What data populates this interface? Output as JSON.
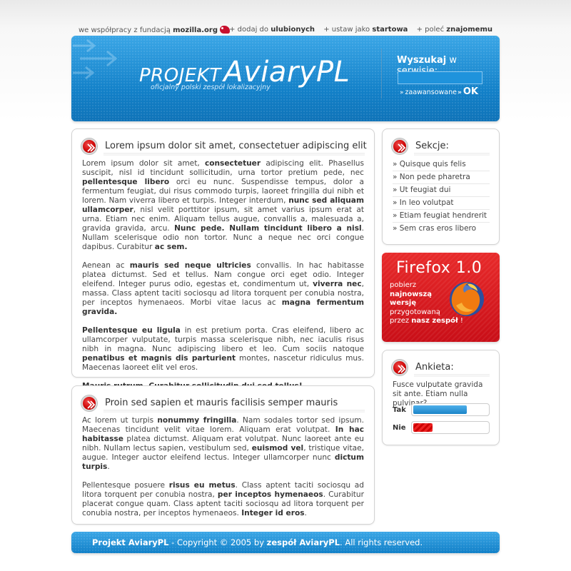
{
  "topbar": {
    "partner_prefix": "we współpracy z fundacją",
    "partner_name": "mozilla.org",
    "links": [
      {
        "prefix": "+ dodaj do",
        "bold": "ulubionych"
      },
      {
        "prefix": "+ ustaw jako",
        "bold": "startowa"
      },
      {
        "prefix": "+ poleć",
        "bold": "znajomemu"
      }
    ]
  },
  "header": {
    "title_part1": "PROJEKT",
    "title_part2": "AviaryPL",
    "subtitle": "oficjalny polski zespół lokalizacyjny",
    "search_label_bold": "Wyszukaj",
    "search_label_rest": "w serwisie:",
    "search_value": "",
    "advanced_label": "zaawansowane",
    "ok_label": "OK"
  },
  "articles": [
    {
      "title": "Lorem ipsum dolor sit amet, consectetuer adipiscing elit",
      "paragraphs": [
        [
          {
            "t": "Lorem ipsum dolor sit amet, "
          },
          {
            "t": "consectetuer",
            "b": true
          },
          {
            "t": " adipiscing elit. Phasellus suscipit, nisl id tincidunt sollicitudin, urna tortor pretium pede, nec "
          },
          {
            "t": "pellentesque libero",
            "b": true
          },
          {
            "t": " orci eu nunc. Suspendisse tempus, dolor a fermentum feugiat, dui risus commodo turpis, laoreet fringilla dui nibh et lorem. Nam viverra libero et turpis. Integer interdum, "
          },
          {
            "t": "nunc sed aliquam ullamcorper",
            "b": true
          },
          {
            "t": ", nisl velit porttitor ipsum, sit amet varius ipsum erat at urna. Etiam nec enim. Aliquam tellus augue, convallis a, malesuada a, gravida gravida, arcu. "
          },
          {
            "t": "Nunc pede. Nullam tincidunt libero a nisl",
            "b": true
          },
          {
            "t": ". Nullam scelerisque odio non tortor. Nunc a neque nec orci congue dapibus. Curabitur "
          },
          {
            "t": "ac sem.",
            "b": true
          }
        ],
        [
          {
            "t": "Aenean ac "
          },
          {
            "t": "mauris sed neque ultricies",
            "b": true
          },
          {
            "t": " convallis. In hac habitasse platea dictumst. Sed et tellus. Nam congue orci eget odio. Integer eleifend. Integer purus odio, egestas et, condimentum ut, "
          },
          {
            "t": "viverra nec",
            "b": true
          },
          {
            "t": ", massa. Class aptent taciti sociosqu ad litora torquent per conubia nostra, per inceptos hymenaeos. Morbi vitae lacus ac "
          },
          {
            "t": "magna fermentum gravida.",
            "b": true
          }
        ],
        [
          {
            "t": "Pellentesque eu ligula",
            "b": true
          },
          {
            "t": " in est pretium porta. Cras eleifend, libero ac ullamcorper vulputate, turpis massa scelerisque nibh, nec iaculis risus nibh in magna. Nunc adipiscing libero et leo. Cum sociis natoque "
          },
          {
            "t": "penatibus et magnis dis parturient",
            "b": true
          },
          {
            "t": " montes, nascetur ridiculus mus. Maecenas laoreet elit vel eros."
          }
        ],
        [
          {
            "t": "Mauris rutrum. Curabitur sollicitudin dui sed tellus!",
            "b": true
          }
        ]
      ]
    },
    {
      "title": "Proin sed sapien et mauris facilisis semper mauris",
      "paragraphs": [
        [
          {
            "t": "Ac lorem ut turpis "
          },
          {
            "t": "nonummy fringilla",
            "b": true
          },
          {
            "t": ". Nam sodales tortor sed ipsum. Maecenas tincidunt velit vitae lorem. Aliquam erat volutpat. "
          },
          {
            "t": "In hac habitasse",
            "b": true
          },
          {
            "t": " platea dictumst. Aliquam erat volutpat. Nunc laoreet ante eu nibh. Nullam lectus sapien, vestibulum sed, "
          },
          {
            "t": "euismod vel",
            "b": true
          },
          {
            "t": ", tristique vitae, augue. Integer auctor eleifend lectus. Integer ullamcorper nunc "
          },
          {
            "t": "dictum turpis",
            "b": true
          },
          {
            "t": "."
          }
        ],
        [
          {
            "t": "Pellentesque posuere "
          },
          {
            "t": "risus eu metus",
            "b": true
          },
          {
            "t": ". Class aptent taciti sociosqu ad litora torquent per conubia nostra, "
          },
          {
            "t": "per inceptos hymenaeos",
            "b": true
          },
          {
            "t": ". Curabitur placerat congue quam. Class aptent taciti sociosqu ad litora torquent per conubia nostra, per inceptos hymenaeos. "
          },
          {
            "t": "Integer id eros",
            "b": true
          },
          {
            "t": "."
          }
        ]
      ]
    }
  ],
  "sidebar": {
    "sections_title": "Sekcje:",
    "items": [
      "» Quisque quis felis",
      "» Non pede pharetra",
      "» Ut feugiat dui",
      "» In leo volutpat",
      "» Etiam feugiat hendrerit",
      "» Sem cras eros libero"
    ]
  },
  "firefox_promo": {
    "title": "Firefox 1.0",
    "line1": "pobierz",
    "line2_bold": "najnowszą",
    "line3_bold": "wersję",
    "line4": "przygotowaną",
    "line5_prefix": "przez",
    "line5_bold": "nasz zespół",
    "line5_suffix": "!"
  },
  "poll": {
    "title": "Ankieta:",
    "question": "Fusce vulputate gravida sit ante. Etiam nulla pulvinar?",
    "options": [
      {
        "label": "Tak",
        "value": 0.72,
        "color": "#1c84c8"
      },
      {
        "label": "Nie",
        "value": 0.26,
        "color": "#dd1111"
      }
    ]
  },
  "footer": {
    "site_bold": "Projekt AviaryPL",
    "copyright_mid": " - Copyright © 2005 by ",
    "team_bold": "zespół AviaryPL",
    "rights": ". All rights reserved."
  },
  "colors": {
    "brand_blue": "#1e8ad0",
    "accent_red": "#d9121d"
  }
}
